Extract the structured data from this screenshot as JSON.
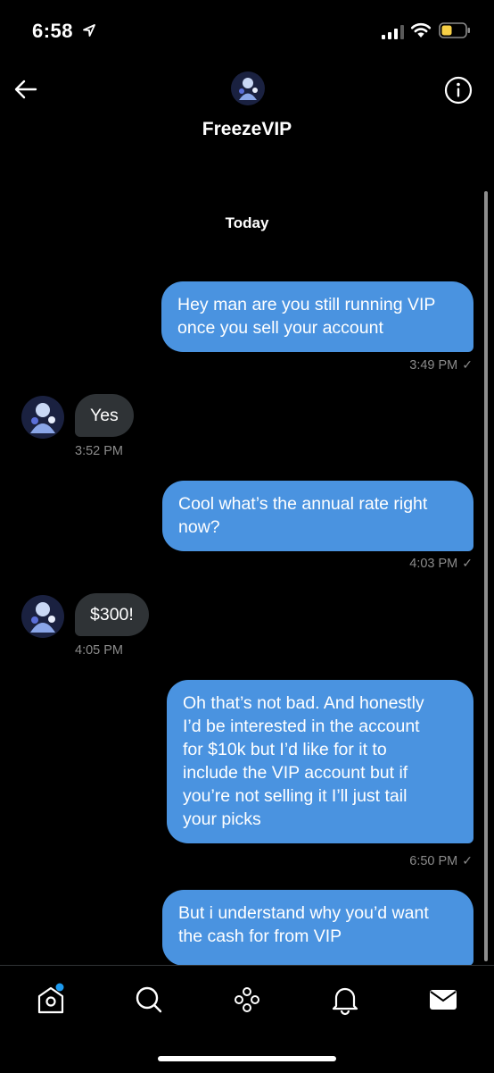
{
  "status_bar": {
    "time": "6:58"
  },
  "header": {
    "name": "FreezeVIP"
  },
  "conversation": {
    "date_label": "Today",
    "messages": [
      {
        "direction": "outgoing",
        "lines": [
          "Hey man are you still running VIP",
          "once you sell your account"
        ],
        "time": "3:49 PM"
      },
      {
        "direction": "incoming",
        "lines": [
          "Yes"
        ],
        "time": "3:52 PM"
      },
      {
        "direction": "outgoing",
        "lines": [
          "Cool what’s the annual rate right",
          "now?"
        ],
        "time": "4:03 PM"
      },
      {
        "direction": "incoming",
        "lines": [
          "$300!"
        ],
        "time": "4:05 PM"
      },
      {
        "direction": "outgoing",
        "lines": [
          "Oh that’s not bad. And honestly",
          "I’d be interested in the account",
          "for $10k but I’d like for it to",
          "include the VIP account but if",
          "you’re not selling it I’ll just tail",
          "your picks"
        ],
        "time": "6:50 PM"
      },
      {
        "direction": "outgoing",
        "lines": [
          "But i understand why you’d want",
          "the cash for from VIP"
        ],
        "time": ""
      }
    ]
  },
  "tabbar": {
    "tabs": [
      {
        "icon": "home-icon",
        "badge": true
      },
      {
        "icon": "search-icon",
        "badge": false
      },
      {
        "icon": "spaces-icon",
        "badge": false
      },
      {
        "icon": "bell-icon",
        "badge": false
      },
      {
        "icon": "mail-icon",
        "badge": false
      }
    ]
  },
  "colors": {
    "accent": "#4a93e0",
    "incoming_bubble": "#2f3336",
    "badge": "#1d9bf0",
    "battery": "#f7d046"
  }
}
